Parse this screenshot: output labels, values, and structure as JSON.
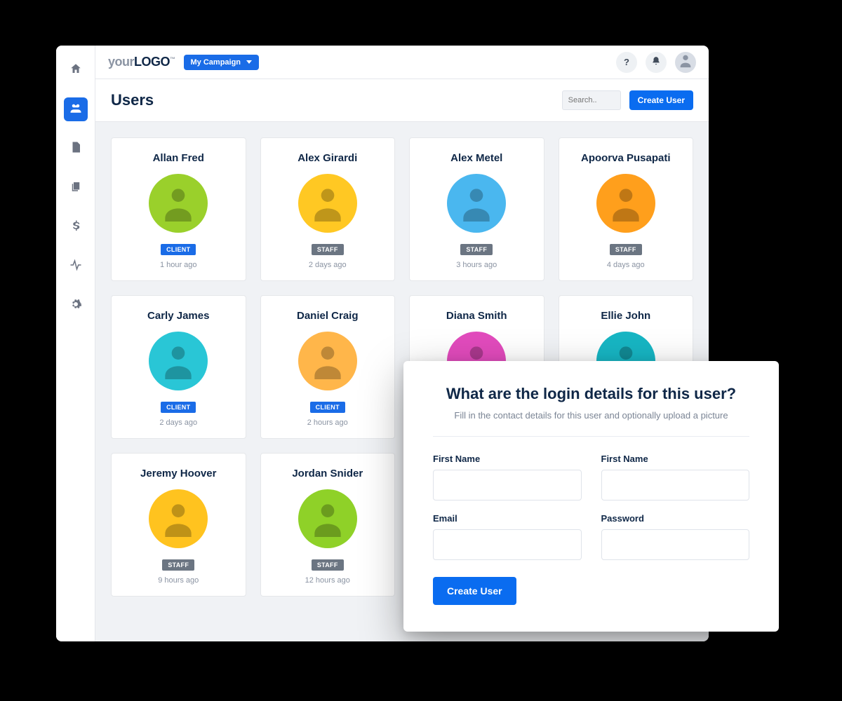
{
  "brand": {
    "part1": "your",
    "part2": "LOGO",
    "tm": "™"
  },
  "campaign": {
    "label": "My Campaign"
  },
  "topbar": {
    "help_label": "?",
    "search_placeholder": "Search.."
  },
  "page": {
    "title": "Users",
    "create_label": "Create User"
  },
  "users": [
    {
      "name": "Allan Fred",
      "role": "CLIENT",
      "time": "1 hour ago",
      "color": "bg-lime"
    },
    {
      "name": "Alex Girardi",
      "role": "STAFF",
      "time": "2 days ago",
      "color": "bg-yellow"
    },
    {
      "name": "Alex Metel",
      "role": "STAFF",
      "time": "3 hours ago",
      "color": "bg-sky"
    },
    {
      "name": "Apoorva Pusapati",
      "role": "STAFF",
      "time": "4 days ago",
      "color": "bg-orange"
    },
    {
      "name": "Carly James",
      "role": "CLIENT",
      "time": "2 days ago",
      "color": "bg-cyan"
    },
    {
      "name": "Daniel Craig",
      "role": "CLIENT",
      "time": "2 hours ago",
      "color": "bg-amber"
    },
    {
      "name": "Diana Smith",
      "role": "",
      "time": "",
      "color": "bg-pink"
    },
    {
      "name": "Ellie John",
      "role": "",
      "time": "",
      "color": "bg-teal"
    },
    {
      "name": "Jeremy Hoover",
      "role": "STAFF",
      "time": "9 hours ago",
      "color": "bg-gold"
    },
    {
      "name": "Jordan Snider",
      "role": "STAFF",
      "time": "12 hours ago",
      "color": "bg-green"
    }
  ],
  "modal": {
    "title": "What are the login details for this user?",
    "subtitle": "Fill in the contact details for this user and optionally upload a picture",
    "fields": {
      "first_name_a": "First Name",
      "first_name_b": "First Name",
      "email": "Email",
      "password": "Password"
    },
    "submit_label": "Create User"
  }
}
